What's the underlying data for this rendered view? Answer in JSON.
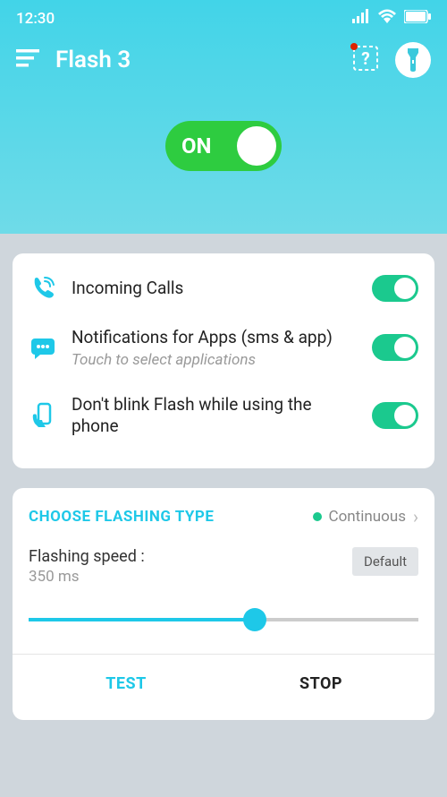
{
  "status": {
    "time": "12:30"
  },
  "app": {
    "title": "Flash 3"
  },
  "main_toggle": {
    "label": "ON",
    "on": true
  },
  "options": {
    "calls": {
      "label": "Incoming Calls",
      "on": true
    },
    "notifications": {
      "label": "Notifications for Apps (sms & app)",
      "sub": "Touch to select applications",
      "on": true
    },
    "no_blink": {
      "label": "Don't blink Flash while using the phone",
      "on": true
    }
  },
  "flashing": {
    "section_title": "CHOOSE FLASHING TYPE",
    "type_label": "Continuous",
    "speed_label": "Flashing speed :",
    "speed_value": "350 ms",
    "default_label": "Default"
  },
  "buttons": {
    "test": "TEST",
    "stop": "STOP"
  }
}
